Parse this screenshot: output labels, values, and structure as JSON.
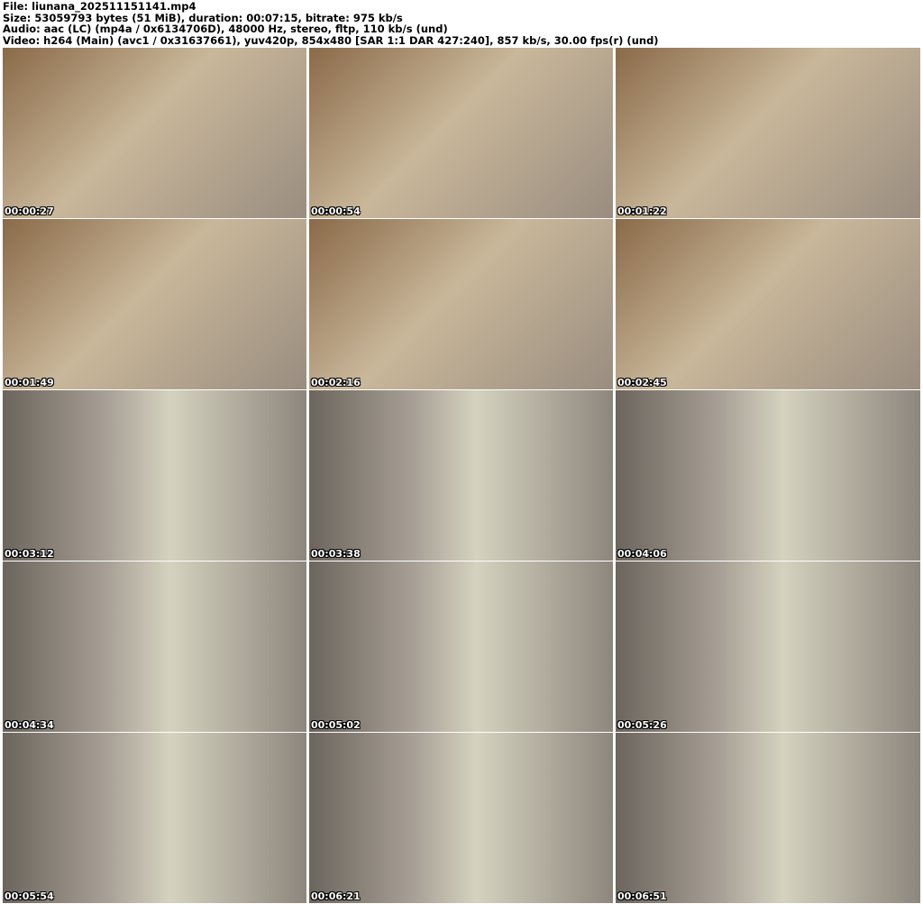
{
  "header": {
    "file": "File: liunana_202511151141.mp4",
    "size": "Size: 53059793 bytes (51 MiB), duration: 00:07:15, bitrate: 975 kb/s",
    "audio": "Audio: aac (LC) (mp4a / 0x6134706D), 48000 Hz, stereo, fltp, 110 kb/s (und)",
    "video": "Video: h264 (Main) (avc1 / 0x31637661), yuv420p, 854x480 [SAR 1:1 DAR 427:240], 857 kb/s, 30.00 fps(r) (und)"
  },
  "thumbnails": [
    {
      "timestamp": "00:00:27",
      "tone": "warm"
    },
    {
      "timestamp": "00:00:54",
      "tone": "warm"
    },
    {
      "timestamp": "00:01:22",
      "tone": "warm"
    },
    {
      "timestamp": "00:01:49",
      "tone": "warm"
    },
    {
      "timestamp": "00:02:16",
      "tone": "warm"
    },
    {
      "timestamp": "00:02:45",
      "tone": "warm"
    },
    {
      "timestamp": "00:03:12",
      "tone": "cool"
    },
    {
      "timestamp": "00:03:38",
      "tone": "cool"
    },
    {
      "timestamp": "00:04:06",
      "tone": "cool"
    },
    {
      "timestamp": "00:04:34",
      "tone": "cool"
    },
    {
      "timestamp": "00:05:02",
      "tone": "cool"
    },
    {
      "timestamp": "00:05:26",
      "tone": "cool"
    },
    {
      "timestamp": "00:05:54",
      "tone": "cool"
    },
    {
      "timestamp": "00:06:21",
      "tone": "cool"
    },
    {
      "timestamp": "00:06:51",
      "tone": "cool"
    }
  ]
}
